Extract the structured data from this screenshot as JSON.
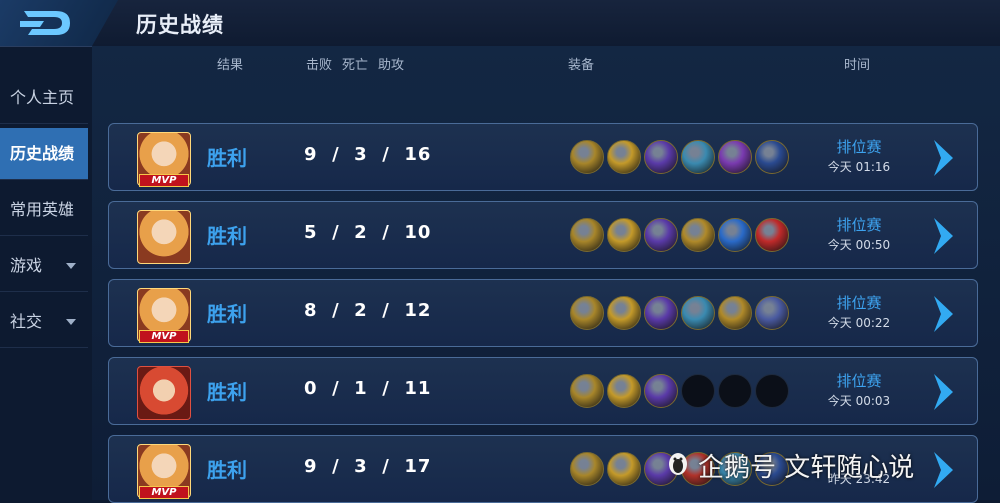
{
  "header": {
    "title": "历史战绩",
    "back_icon": "back-icon"
  },
  "sidebar": {
    "items": [
      {
        "label": "个人主页",
        "active": false,
        "has_caret": false
      },
      {
        "label": "历史战绩",
        "active": true,
        "has_caret": false
      },
      {
        "label": "常用英雄",
        "active": false,
        "has_caret": false
      },
      {
        "label": "游戏",
        "active": false,
        "has_caret": true
      },
      {
        "label": "社交",
        "active": false,
        "has_caret": true
      }
    ]
  },
  "columns": {
    "result": "结果",
    "kills": "击败",
    "deaths": "死亡",
    "assists": "助攻",
    "equipment": "装备",
    "time": "时间"
  },
  "matches": [
    {
      "result": "胜利",
      "kills": 9,
      "deaths": 3,
      "assists": 16,
      "mvp": true,
      "avatar": "hero-portrait-blonde",
      "items": [
        "#a8862a",
        "#c49a2a",
        "#5a3aa8",
        "#3a8ab0",
        "#7a3ab0",
        "#2a4a90"
      ],
      "mode": "排位赛",
      "time": "今天 01:16"
    },
    {
      "result": "胜利",
      "kills": 5,
      "deaths": 2,
      "assists": 10,
      "mvp": false,
      "avatar": "hero-portrait-blonde",
      "items": [
        "#a8862a",
        "#c49a2a",
        "#5a3aa8",
        "#b08a2a",
        "#2a6ac8",
        "#c02a2a"
      ],
      "mode": "排位赛",
      "time": "今天 00:50"
    },
    {
      "result": "胜利",
      "kills": 8,
      "deaths": 2,
      "assists": 12,
      "mvp": true,
      "avatar": "hero-portrait-blonde",
      "items": [
        "#a8862a",
        "#c49a2a",
        "#5a3aa8",
        "#3a8ab0",
        "#b08a2a",
        "#4a5aa0"
      ],
      "mode": "排位赛",
      "time": "今天 00:22"
    },
    {
      "result": "胜利",
      "kills": 0,
      "deaths": 1,
      "assists": 11,
      "mvp": false,
      "avatar": "hero-portrait-red",
      "items": [
        "#a8862a",
        "#c49a2a",
        "#5a3aa8",
        "empty",
        "empty",
        "empty"
      ],
      "mode": "排位赛",
      "time": "今天 00:03"
    },
    {
      "result": "胜利",
      "kills": 9,
      "deaths": 3,
      "assists": 17,
      "mvp": true,
      "avatar": "hero-portrait-blonde",
      "items": [
        "#a8862a",
        "#c49a2a",
        "#5a3aa8",
        "#b0322a",
        "#3a8ab0",
        "#2a4a90"
      ],
      "mode": "",
      "time": "昨天 23:42"
    }
  ],
  "watermark": {
    "text": "企鹅号 文轩随心说",
    "icon": "penguin-icon"
  },
  "colors": {
    "accent": "#3da2ee",
    "active_tab": "#2f6fb3",
    "background": "#0d1a30"
  }
}
